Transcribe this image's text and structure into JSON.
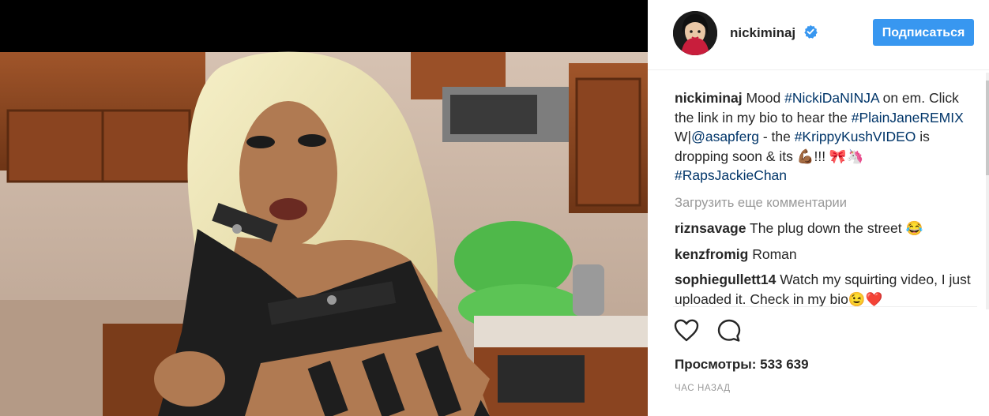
{
  "post": {
    "username": "nickiminaj",
    "follow_label": "Подписаться",
    "caption_text_1": "Mood ",
    "caption_tag_1": "#NickiDaNINJA",
    "caption_text_2": " on em. Click the link in my bio to hear the ",
    "caption_tag_2": "#PlainJaneREMIX",
    "caption_text_3": " W|",
    "caption_mention": "@asapferg",
    "caption_text_4": " - the ",
    "caption_tag_3": "#KrippyKushVIDEO",
    "caption_text_5": " is dropping soon & its ",
    "caption_emojis": "💪🏾!!! 🎀🦄 ",
    "caption_tag_4": "#RapsJackieChan",
    "load_more": "Загрузить еще комментарии",
    "comments": [
      {
        "user": "riznsavage",
        "text": "The plug down the street 😂"
      },
      {
        "user": "kenzfromig",
        "text": "Roman"
      },
      {
        "user": "sophiegullett14",
        "text": "Watch my squirting video, I just uploaded it. Check in my bio😉❤️"
      }
    ],
    "views": "Просмотры: 533 639",
    "timestamp": "час назад"
  },
  "icons": {
    "verified": "verified-badge-icon",
    "like": "heart-icon",
    "comment": "comment-bubble-icon"
  },
  "colors": {
    "accent": "#3897f0",
    "hashtag": "#003569",
    "muted": "#999999"
  }
}
